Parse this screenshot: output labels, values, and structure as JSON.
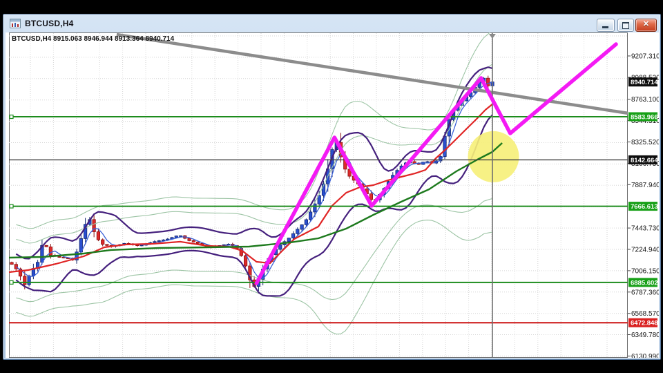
{
  "window": {
    "title": "BTCUSD,H4",
    "controls": {
      "close_label": "✕"
    }
  },
  "chart": {
    "info_line": "BTCUSD,H4  8915.063 8946.944 8913.364 8940.714",
    "axis_ticks": [
      {
        "label": "9207.310",
        "price": 9207.31
      },
      {
        "label": "8988.520",
        "price": 8988.52
      },
      {
        "label": "8763.100",
        "price": 8763.1
      },
      {
        "label": "8544.310",
        "price": 8544.31
      },
      {
        "label": "8325.520",
        "price": 8325.52
      },
      {
        "label": "8106.730",
        "price": 8106.73
      },
      {
        "label": "7887.940",
        "price": 7887.94
      },
      {
        "label": "7443.730",
        "price": 7443.73
      },
      {
        "label": "7224.940",
        "price": 7224.94
      },
      {
        "label": "7006.150",
        "price": 7006.15
      },
      {
        "label": "6787.360",
        "price": 6787.36
      },
      {
        "label": "6568.570",
        "price": 6568.57
      },
      {
        "label": "6349.780",
        "price": 6349.78
      },
      {
        "label": "6130.990",
        "price": 6130.99
      }
    ],
    "levels": [
      {
        "label": "8940.714",
        "price": 8940.714,
        "badge_bg": "#0d0d0d",
        "line": false,
        "kind": "current-price"
      },
      {
        "label": "8583.966",
        "price": 8583.966,
        "badge_bg": "#17a017",
        "line": true,
        "line_color": "#1d8c1d",
        "line_width": 2,
        "handle": true,
        "kind": "support-resistance"
      },
      {
        "label": "8142.664",
        "price": 8142.664,
        "badge_bg": "#0d0d0d",
        "line": true,
        "line_color": "#3c3c3c",
        "line_width": 1.4,
        "handle": false,
        "kind": "horizontal-line"
      },
      {
        "label": "7666.613",
        "price": 7666.613,
        "badge_bg": "#17a017",
        "line": true,
        "line_color": "#1d8c1d",
        "line_width": 2,
        "handle": true,
        "kind": "support-resistance"
      },
      {
        "label": "6885.602",
        "price": 6885.602,
        "badge_bg": "#17a017",
        "line": true,
        "line_color": "#1d8c1d",
        "line_width": 2,
        "handle": true,
        "kind": "support-resistance"
      },
      {
        "label": "6472.848",
        "price": 6472.848,
        "badge_bg": "#d92020",
        "line": true,
        "line_color": "#cc1111",
        "line_width": 2,
        "handle": false,
        "kind": "stop-level"
      }
    ],
    "objects": {
      "trendline": {
        "from_x": 0.174,
        "from_price": 9427,
        "to_x": 1.0,
        "to_price": 8620,
        "color": "#8c8c8c",
        "width": 4.5
      },
      "vertical_line": {
        "x": 0.7812,
        "color": "#6f6f6f",
        "width": 1.6,
        "marker_color": "#8a8a8a"
      },
      "highlight_circle": {
        "x": 0.7829,
        "price": 8174,
        "radius": 37,
        "color": "#f6ef78",
        "opacity": 0.9
      },
      "zigzag": {
        "color": "#f41af4",
        "width": 5.5,
        "points": [
          [
            0.4,
            6878
          ],
          [
            0.526,
            8372
          ],
          [
            0.586,
            7671
          ],
          [
            0.763,
            8981
          ],
          [
            0.81,
            8414
          ],
          [
            0.981,
            9328
          ]
        ]
      }
    }
  },
  "chart_data": {
    "type": "candlestick",
    "symbol": "BTCUSD",
    "timeframe": "H4",
    "last_ohlc": {
      "open": 8915.063,
      "high": 8946.944,
      "low": 8913.364,
      "close": 8940.714
    },
    "y_range": {
      "top": 9441,
      "bottom": 6120
    },
    "tick_step": 218.79,
    "candle_count": 112,
    "price_path": [
      [
        0.002,
        7083
      ],
      [
        0.009,
        7048
      ],
      [
        0.017,
        6970
      ],
      [
        0.025,
        6857
      ],
      [
        0.036,
        6998
      ],
      [
        0.047,
        7097
      ],
      [
        0.056,
        7331
      ],
      [
        0.065,
        7168
      ],
      [
        0.078,
        7147
      ],
      [
        0.093,
        7133
      ],
      [
        0.105,
        7111
      ],
      [
        0.118,
        7366
      ],
      [
        0.128,
        7578
      ],
      [
        0.136,
        7422
      ],
      [
        0.148,
        7281
      ],
      [
        0.167,
        7253
      ],
      [
        0.188,
        7288
      ],
      [
        0.21,
        7260
      ],
      [
        0.234,
        7303
      ],
      [
        0.257,
        7331
      ],
      [
        0.275,
        7373
      ],
      [
        0.29,
        7317
      ],
      [
        0.308,
        7281
      ],
      [
        0.324,
        7239
      ],
      [
        0.342,
        7267
      ],
      [
        0.357,
        7281
      ],
      [
        0.371,
        7225
      ],
      [
        0.382,
        7062
      ],
      [
        0.391,
        6878
      ],
      [
        0.398,
        6835
      ],
      [
        0.41,
        7019
      ],
      [
        0.423,
        7161
      ],
      [
        0.436,
        7260
      ],
      [
        0.451,
        7331
      ],
      [
        0.465,
        7422
      ],
      [
        0.479,
        7514
      ],
      [
        0.491,
        7649
      ],
      [
        0.503,
        7798
      ],
      [
        0.513,
        7982
      ],
      [
        0.522,
        8244
      ],
      [
        0.53,
        8329
      ],
      [
        0.54,
        8081
      ],
      [
        0.551,
        7968
      ],
      [
        0.564,
        7897
      ],
      [
        0.577,
        7805
      ],
      [
        0.589,
        7706
      ],
      [
        0.604,
        7826
      ],
      [
        0.618,
        7968
      ],
      [
        0.633,
        8074
      ],
      [
        0.646,
        8131
      ],
      [
        0.66,
        8088
      ],
      [
        0.673,
        8131
      ],
      [
        0.686,
        8103
      ],
      [
        0.698,
        8181
      ],
      [
        0.708,
        8507
      ],
      [
        0.718,
        8649
      ],
      [
        0.728,
        8720
      ],
      [
        0.738,
        8784
      ],
      [
        0.748,
        8841
      ],
      [
        0.758,
        8926
      ],
      [
        0.767,
        8983
      ],
      [
        0.773,
        8890
      ],
      [
        0.779,
        8941
      ]
    ],
    "overlays": {
      "red_ma": {
        "color": "#e02525",
        "width": 2.2,
        "points": [
          [
            0.0,
            6991
          ],
          [
            0.031,
            7012
          ],
          [
            0.076,
            7076
          ],
          [
            0.121,
            7154
          ],
          [
            0.154,
            7246
          ],
          [
            0.188,
            7274
          ],
          [
            0.232,
            7281
          ],
          [
            0.277,
            7303
          ],
          [
            0.321,
            7260
          ],
          [
            0.355,
            7253
          ],
          [
            0.377,
            7210
          ],
          [
            0.4,
            7097
          ],
          [
            0.422,
            7083
          ],
          [
            0.444,
            7225
          ],
          [
            0.461,
            7331
          ],
          [
            0.478,
            7387
          ],
          [
            0.5,
            7458
          ],
          [
            0.522,
            7671
          ],
          [
            0.545,
            7805
          ],
          [
            0.567,
            7862
          ],
          [
            0.589,
            7883
          ],
          [
            0.612,
            7932
          ],
          [
            0.634,
            7968
          ],
          [
            0.656,
            8003
          ],
          [
            0.673,
            8039
          ],
          [
            0.69,
            8159
          ],
          [
            0.706,
            8251
          ],
          [
            0.723,
            8357
          ],
          [
            0.74,
            8464
          ],
          [
            0.757,
            8570
          ],
          [
            0.77,
            8655
          ],
          [
            0.781,
            8712
          ]
        ]
      },
      "green_ma": {
        "color": "#1d7a1d",
        "width": 2.4,
        "points": [
          [
            0.0,
            7140
          ],
          [
            0.054,
            7147
          ],
          [
            0.121,
            7182
          ],
          [
            0.165,
            7218
          ],
          [
            0.243,
            7239
          ],
          [
            0.321,
            7246
          ],
          [
            0.388,
            7253
          ],
          [
            0.455,
            7296
          ],
          [
            0.5,
            7338
          ],
          [
            0.545,
            7437
          ],
          [
            0.589,
            7579
          ],
          [
            0.634,
            7713
          ],
          [
            0.679,
            7841
          ],
          [
            0.723,
            8025
          ],
          [
            0.757,
            8145
          ],
          [
            0.781,
            8223
          ],
          [
            0.797,
            8315
          ]
        ]
      },
      "blue_ma": {
        "color": "#3a62d8",
        "width": 1.3,
        "window": 4
      },
      "purple_band": {
        "color": "#45207d",
        "width": 2.2,
        "window": 9,
        "k": 2.2,
        "min_offset": 120,
        "max_offset": 430
      },
      "envelope_band": {
        "color": "#9cc4a4",
        "width": 1.1,
        "window": 22,
        "k": 2.0,
        "min_offset": 300,
        "max_offset": 780,
        "outer_mult": 1.5
      }
    },
    "candle_colors": {
      "up_fill": "#2a4fd0",
      "up_stroke": "#14266e",
      "down_fill": "#dd2a2a",
      "down_stroke": "#8a1010"
    }
  }
}
